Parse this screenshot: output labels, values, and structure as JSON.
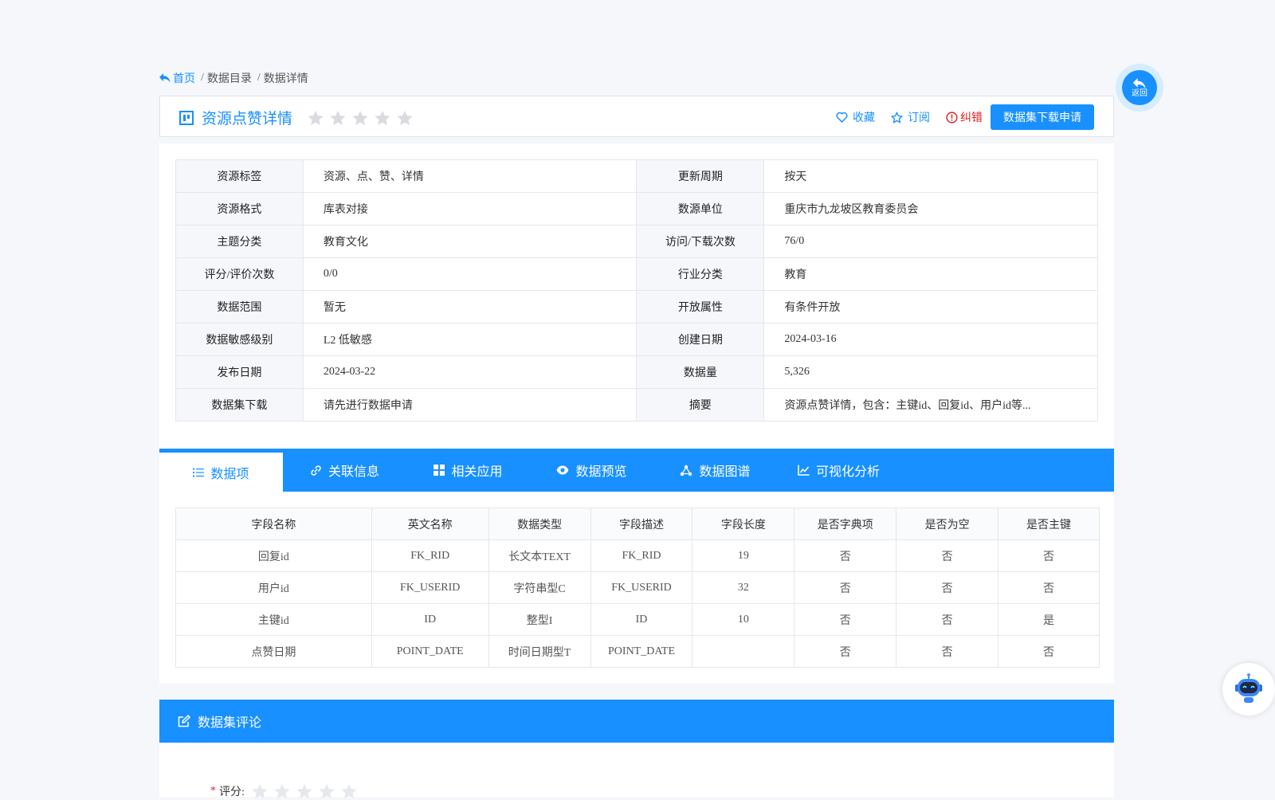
{
  "breadcrumb": {
    "home": "首页",
    "sep": "/",
    "items": [
      "数据目录",
      "数据详情"
    ]
  },
  "header": {
    "title": "资源点赞详情",
    "rating_stars": 5,
    "actions": {
      "favorite": "收藏",
      "subscribe": "订阅",
      "report": "纠错"
    },
    "download_button": "数据集下载申请"
  },
  "info": {
    "rows": [
      [
        {
          "k": "资源标签",
          "v": "资源、点、赞、详情"
        },
        {
          "k": "更新周期",
          "v": "按天"
        }
      ],
      [
        {
          "k": "资源格式",
          "v": "库表对接"
        },
        {
          "k": "数源单位",
          "v": "重庆市九龙坡区教育委员会"
        }
      ],
      [
        {
          "k": "主题分类",
          "v": "教育文化"
        },
        {
          "k": "访问/下载次数",
          "v": "76/0"
        }
      ],
      [
        {
          "k": "评分/评价次数",
          "v": "0/0"
        },
        {
          "k": "行业分类",
          "v": "教育"
        }
      ],
      [
        {
          "k": "数据范围",
          "v": "暂无"
        },
        {
          "k": "开放属性",
          "v": "有条件开放"
        }
      ],
      [
        {
          "k": "数据敏感级别",
          "v": "L2 低敏感"
        },
        {
          "k": "创建日期",
          "v": "2024-03-16"
        }
      ],
      [
        {
          "k": "发布日期",
          "v": "2024-03-22"
        },
        {
          "k": "数据量",
          "v": "5,326"
        }
      ],
      [
        {
          "k": "数据集下载",
          "v": "请先进行数据申请"
        },
        {
          "k": "摘要",
          "v": "资源点赞详情，包含：主键id、回复id、用户id等..."
        }
      ]
    ]
  },
  "tabs": [
    {
      "label": "数据项",
      "icon": "list-icon",
      "active": true
    },
    {
      "label": "关联信息",
      "icon": "link-icon",
      "active": false
    },
    {
      "label": "相关应用",
      "icon": "apps-grid-icon",
      "active": false
    },
    {
      "label": "数据预览",
      "icon": "eye-icon",
      "active": false
    },
    {
      "label": "数据图谱",
      "icon": "graph-icon",
      "active": false
    },
    {
      "label": "可视化分析",
      "icon": "line-chart-icon",
      "active": false
    }
  ],
  "fields_table": {
    "headers": [
      "字段名称",
      "英文名称",
      "数据类型",
      "字段描述",
      "字段长度",
      "是否字典项",
      "是否为空",
      "是否主键"
    ],
    "rows": [
      [
        "回复id",
        "FK_RID",
        "长文本TEXT",
        "FK_RID",
        "19",
        "否",
        "否",
        "否"
      ],
      [
        "用户id",
        "FK_USERID",
        "字符串型C",
        "FK_USERID",
        "32",
        "否",
        "否",
        "否"
      ],
      [
        "主键id",
        "ID",
        "整型I",
        "ID",
        "10",
        "否",
        "否",
        "是"
      ],
      [
        "点赞日期",
        "POINT_DATE",
        "时间日期型T",
        "POINT_DATE",
        "",
        "否",
        "否",
        "否"
      ]
    ]
  },
  "comments": {
    "title": "数据集评论",
    "required_mark": "*",
    "rating_label": "评分:",
    "rating_stars": 5
  },
  "floating": {
    "back_label": "返回"
  },
  "colors": {
    "primary": "#1890ff",
    "error": "#e02020",
    "star_empty": "#d9dbe0"
  }
}
